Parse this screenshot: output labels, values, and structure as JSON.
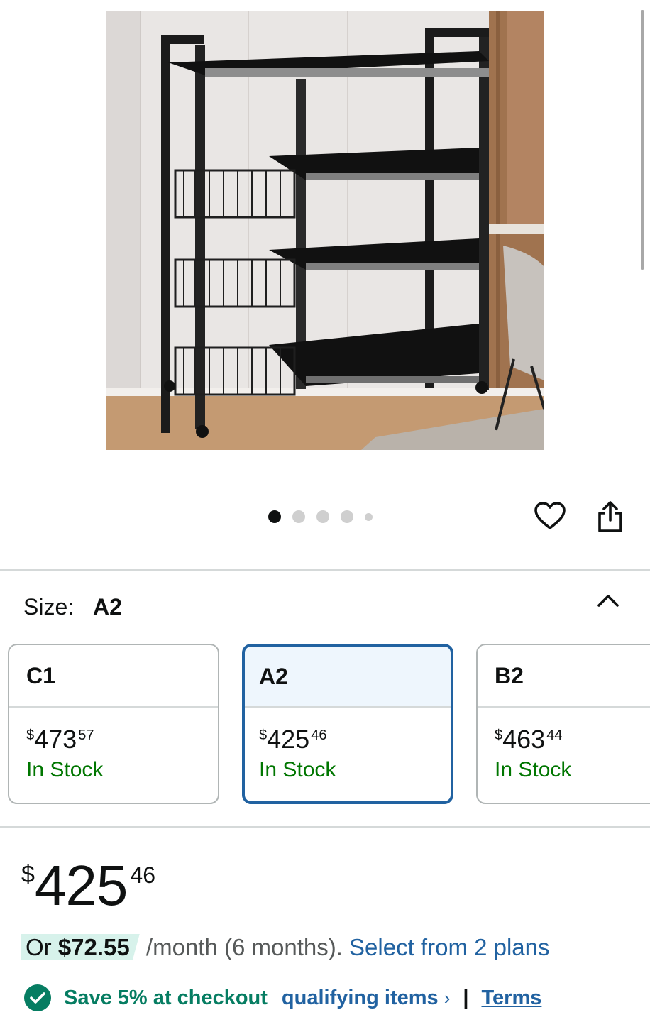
{
  "product": {
    "image_alt": "Black metal kitchen storage rack with wire baskets and shelves",
    "carousel": {
      "count": 5,
      "active": 0
    }
  },
  "actions": {
    "favorite_icon": "heart-icon",
    "share_icon": "share-icon"
  },
  "size_selector": {
    "label": "Size:",
    "selected": "A2",
    "options": [
      {
        "name": "C1",
        "currency": "$",
        "whole": "473",
        "cents": "57",
        "stock": "In Stock",
        "selected": false
      },
      {
        "name": "A2",
        "currency": "$",
        "whole": "425",
        "cents": "46",
        "stock": "In Stock",
        "selected": true
      },
      {
        "name": "B2",
        "currency": "$",
        "whole": "463",
        "cents": "44",
        "stock": "In Stock",
        "selected": false
      }
    ]
  },
  "price": {
    "currency": "$",
    "whole": "425",
    "cents": "46"
  },
  "installment": {
    "prefix": "Or ",
    "amount": "$72.55",
    "suffix": " /month (6 months). ",
    "link": "Select from 2 plans"
  },
  "promo": {
    "save_text": "Save 5% at checkout",
    "qualifying_link": "qualifying items",
    "chevron": "›",
    "separator": "|",
    "terms_link": "Terms"
  },
  "colors": {
    "link": "#2162a1",
    "in_stock": "#007600",
    "promo_green": "#067d62",
    "selected_border": "#2162a1",
    "highlight": "#d7f2eb"
  }
}
